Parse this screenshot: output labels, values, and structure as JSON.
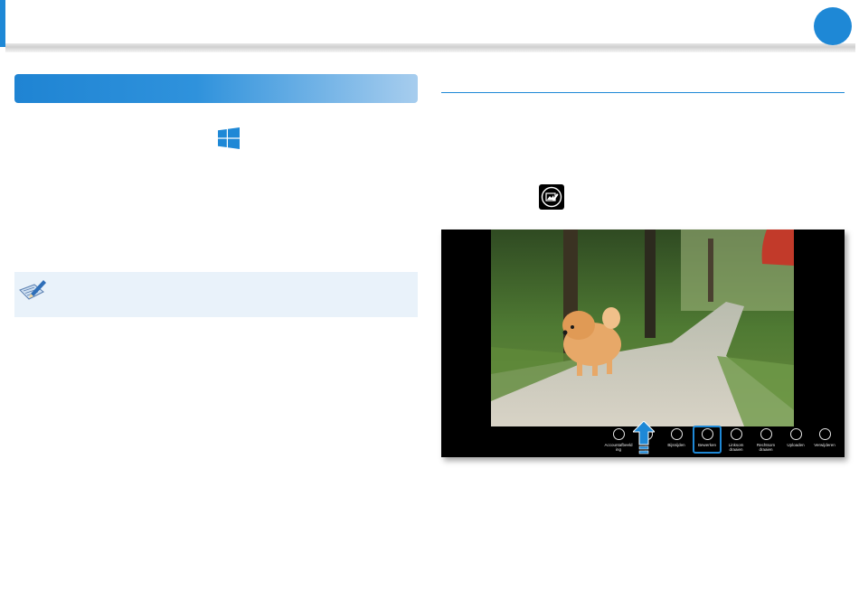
{
  "header": {
    "accent_color": "#1e88d6"
  },
  "screenshot": {
    "appbar_items": [
      {
        "label": "Accountafbeeld\ning",
        "icon": "lock-screen-icon"
      },
      {
        "label": "...\n...",
        "icon": "slideshow-icon"
      },
      {
        "label": "Bijsnijden",
        "icon": "crop-icon"
      },
      {
        "label": "Bewerken",
        "icon": "edit-icon",
        "highlighted": true
      },
      {
        "label": "Linksom\ndraaien",
        "icon": "rotate-left-icon"
      },
      {
        "label": "Rechtsom\ndraaien",
        "icon": "rotate-right-icon"
      },
      {
        "label": "Uploaden",
        "icon": "upload-icon"
      },
      {
        "label": "Verwijderen",
        "icon": "delete-icon"
      }
    ]
  }
}
